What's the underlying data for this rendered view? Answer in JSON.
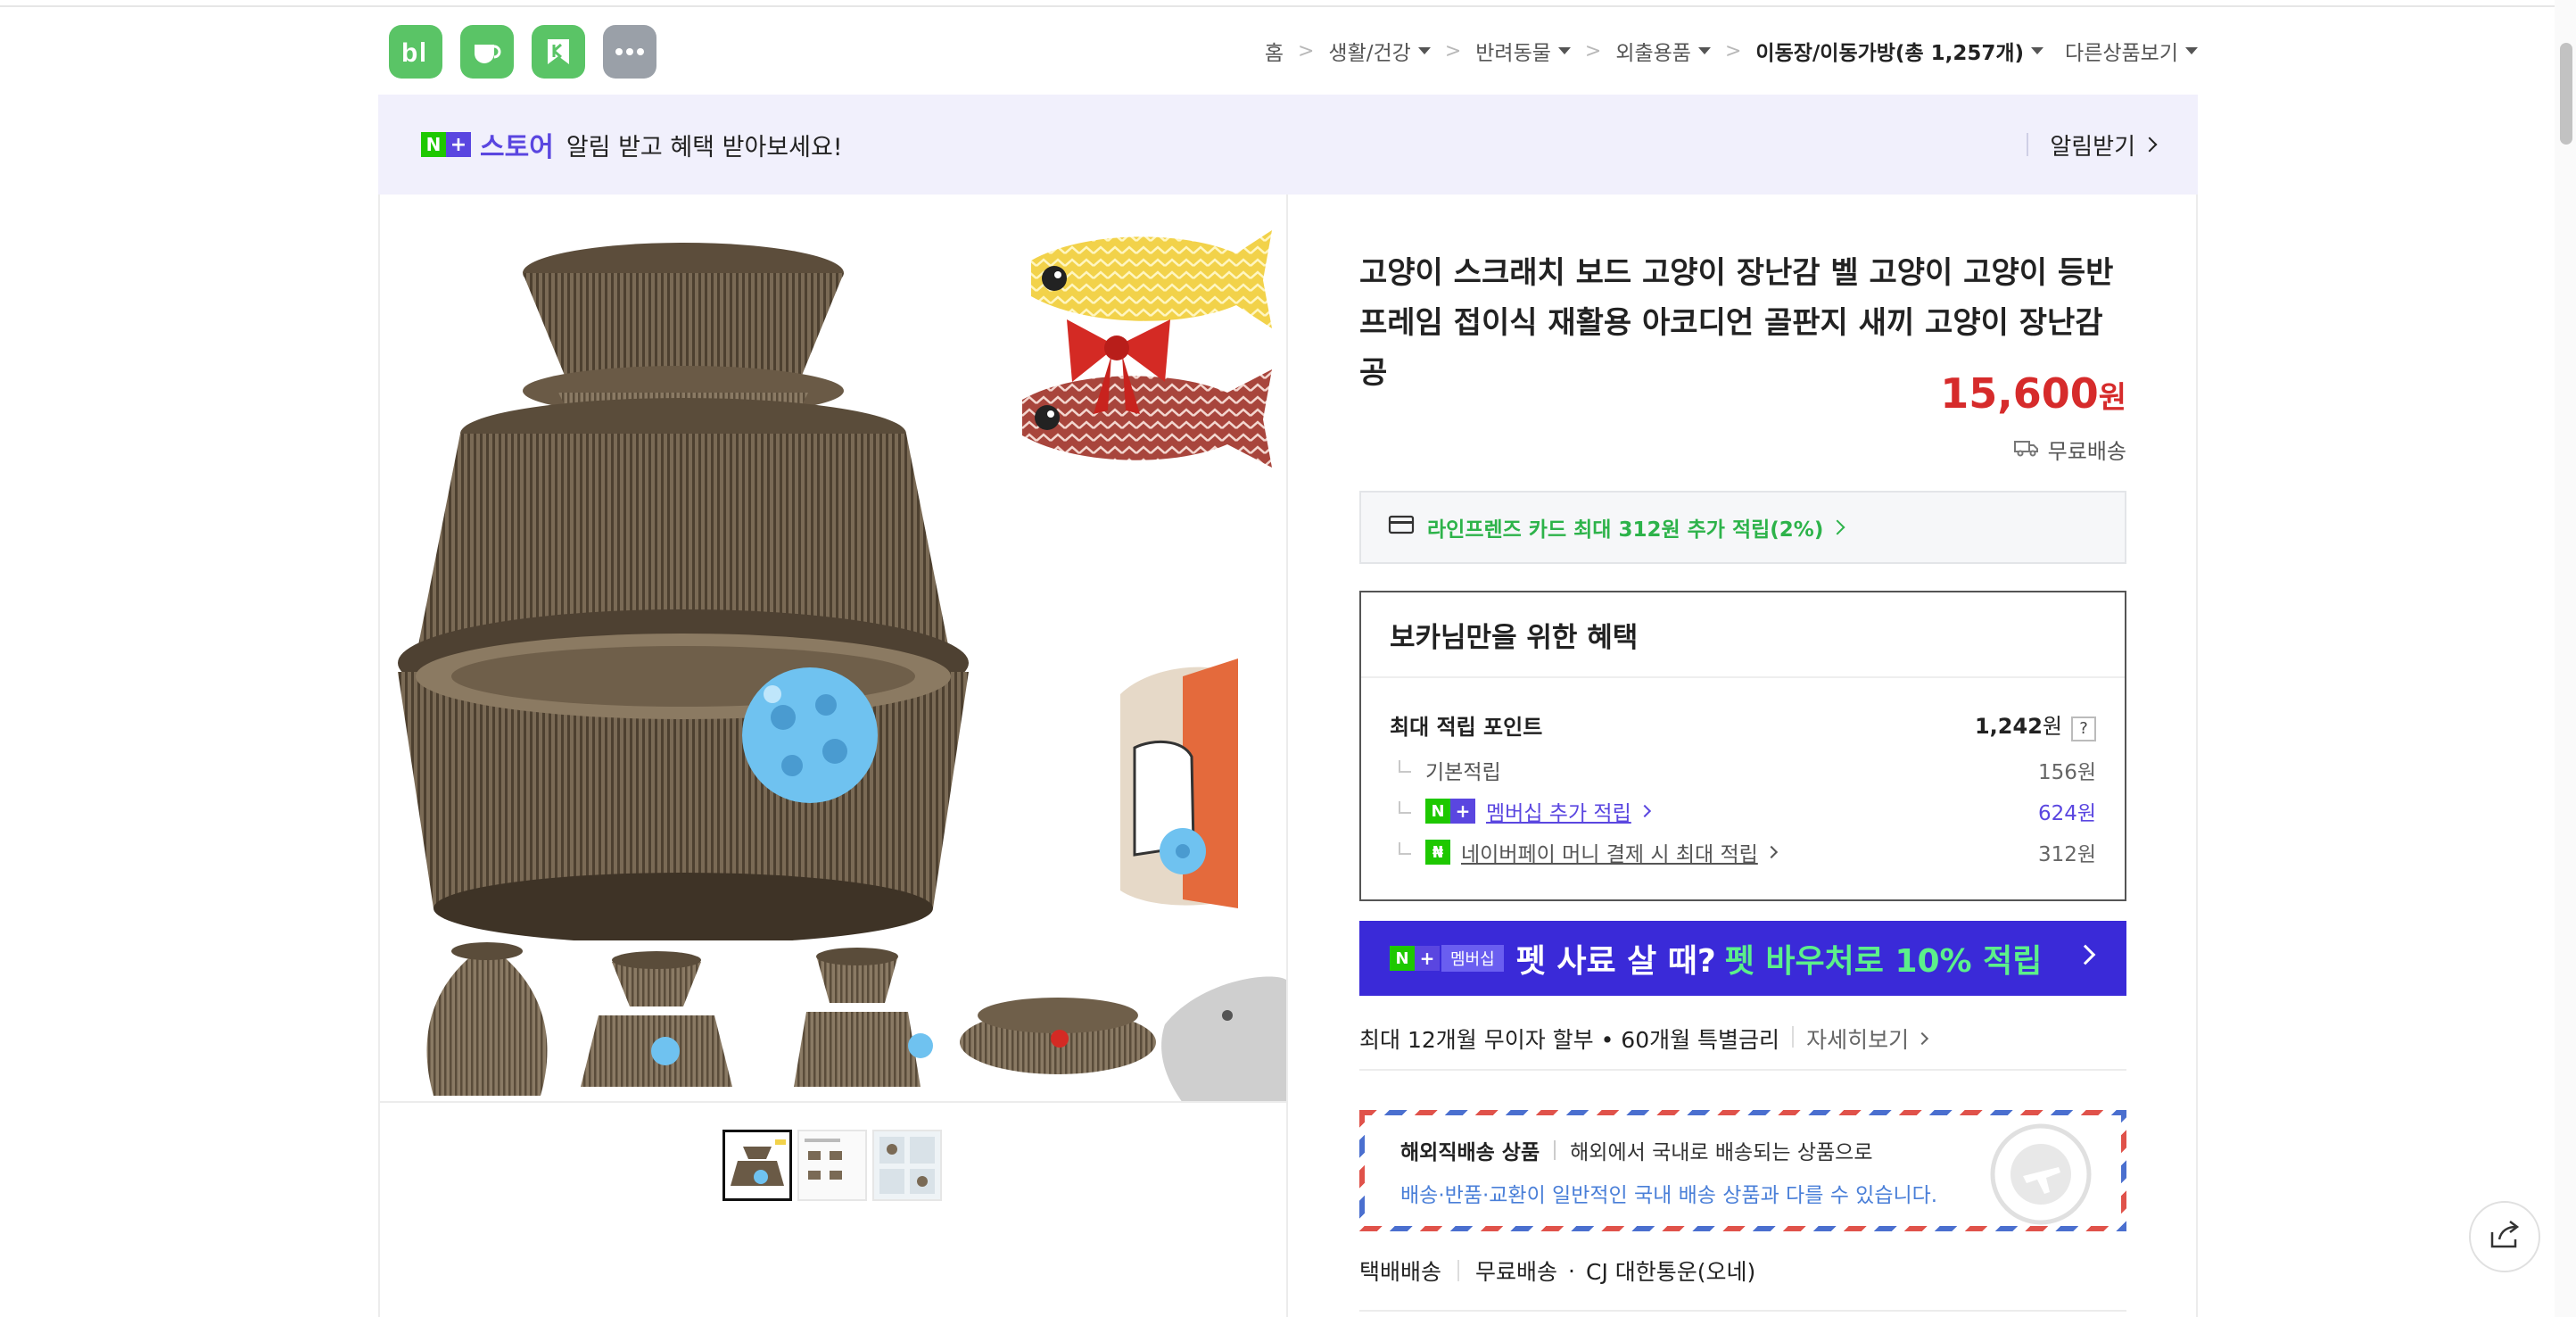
{
  "apps": [
    {
      "name": "blog-app-icon",
      "glyph": "b|"
    },
    {
      "name": "cafe-app-icon",
      "glyph": ""
    },
    {
      "name": "bookmark-app-icon",
      "glyph": ""
    },
    {
      "name": "more-apps-icon",
      "glyph": "···"
    }
  ],
  "breadcrumb": {
    "home": "홈",
    "level1": "생활/건강",
    "level2": "반려동물",
    "level3": "외출용품",
    "current": "이동장/이동가방(총 1,257개)",
    "other": "다른상품보기",
    "separator": ">"
  },
  "banner": {
    "badge_n": "N",
    "badge_plus": "+",
    "store_word": "스토어",
    "text": "알림 받고 혜택 받아보세요!",
    "action": "알림받기"
  },
  "product": {
    "title": "고양이 스크래치 보드 고양이 장난감 벨 고양이 고양이 등반 프레임 접이식 재활용 아코디언 골판지 새끼 고양이 장난감 공",
    "price": "15,600",
    "price_unit": "원",
    "shipping": "무료배송"
  },
  "card_offer": "라인프렌즈 카드 최대 312원 추가 적립(2%)",
  "benefit": {
    "heading": "보카님만을 위한 혜택",
    "max_points_label": "최대 적립 포인트",
    "max_points_value": "1,242",
    "max_points_unit": "원",
    "help": "?",
    "rows": [
      {
        "label": "기본적립",
        "value": "156원"
      },
      {
        "label": "멤버십 추가 적립",
        "value": "624원"
      },
      {
        "label": "네이버페이 머니 결제 시 최대 적립",
        "value": "312원"
      }
    ]
  },
  "membership_banner": {
    "tag": "멤버십",
    "text_white": "펫 사료 살 때?",
    "text_green": "펫 바우처로 10% 적립"
  },
  "installment": {
    "text": "최대 12개월 무이자 할부 • 60개월 특별금리",
    "more": "자세히보기"
  },
  "overseas": {
    "title": "해외직배송 상품",
    "line1": "해외에서 국내로 배송되는 상품으로",
    "line2": "배송·반품·교환이 일반적인 국내 배송 상품과 다를 수 있습니다."
  },
  "delivery": {
    "type": "택배배송",
    "fee": "무료배송",
    "carrier": "CJ 대한통운(오네)",
    "dot": "·"
  },
  "colors": {
    "price_red": "#d62b2b",
    "naver_green": "#1ec800",
    "plus_purple": "#5a46e0",
    "membership_blue": "#3a2ad8"
  }
}
